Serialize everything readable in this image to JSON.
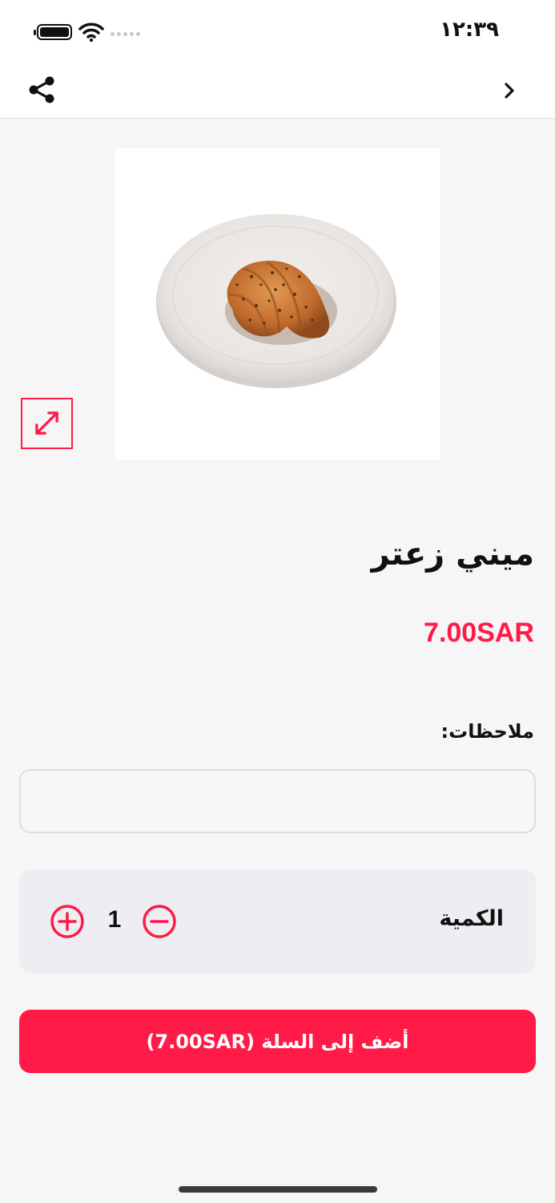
{
  "status_bar": {
    "time": "١٢:٣٩",
    "battery_icon": "battery-icon",
    "wifi_icon": "wifi-icon",
    "signal_icon": "signal-dots-icon"
  },
  "nav": {
    "share_icon": "share-icon",
    "back_icon": "chevron-right-icon"
  },
  "product": {
    "name": "ميني زعتر",
    "price": "7.00SAR",
    "image": "croissant-on-plate",
    "expand_icon": "expand-arrows-icon"
  },
  "notes": {
    "label": "ملاحظات:",
    "value": "",
    "placeholder": ""
  },
  "quantity": {
    "label": "الكمية",
    "value": "1",
    "plus_icon": "plus-circle-icon",
    "minus_icon": "minus-circle-icon"
  },
  "cart_button": {
    "label": "أضف إلى السلة (7.00SAR)"
  },
  "colors": {
    "accent": "#ff1a47",
    "background": "#f6f6f6",
    "card": "#eeeef2"
  }
}
